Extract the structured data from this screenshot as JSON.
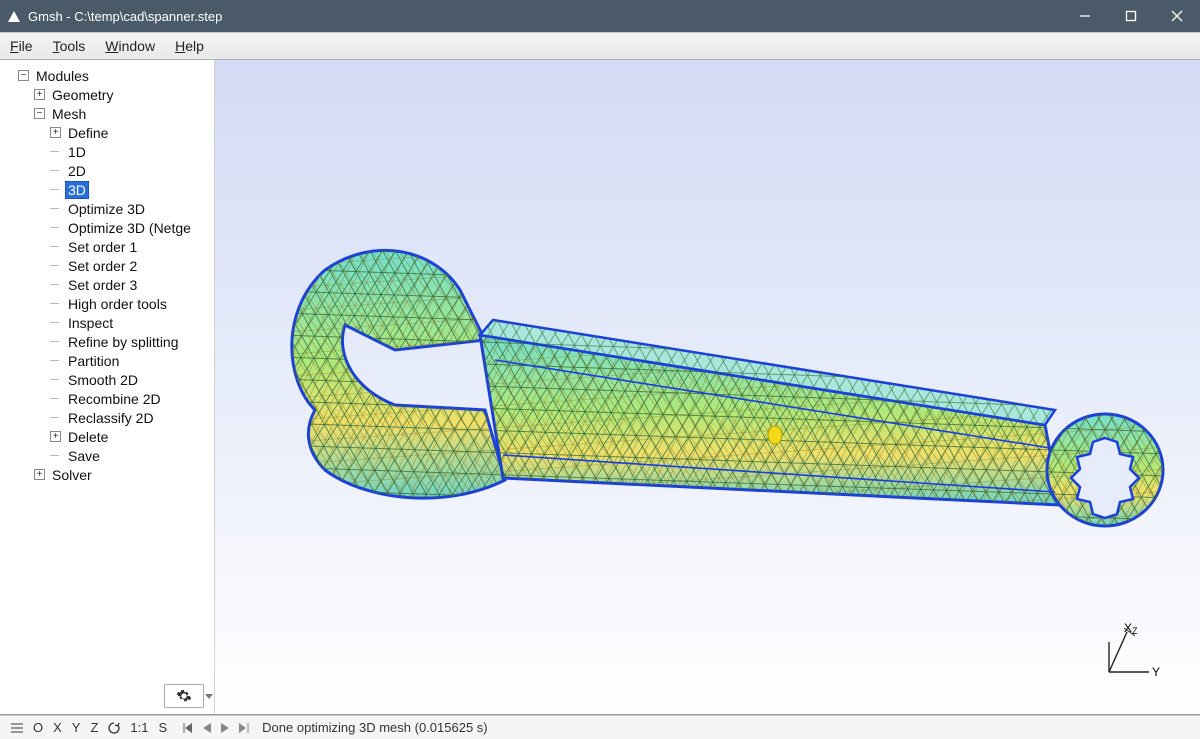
{
  "window": {
    "title": "Gmsh - C:\\temp\\cad\\spanner.step"
  },
  "menu": {
    "file": "File",
    "tools": "Tools",
    "window": "Window",
    "help": "Help"
  },
  "tree": {
    "root": "Modules",
    "geometry": "Geometry",
    "mesh": "Mesh",
    "define": "Define",
    "items": [
      "1D",
      "2D",
      "3D",
      "Optimize 3D",
      "Optimize 3D (Netge",
      "Set order 1",
      "Set order 2",
      "Set order 3",
      "High order tools",
      "Inspect",
      "Refine by splitting",
      "Partition",
      "Smooth 2D",
      "Recombine 2D",
      "Reclassify 2D"
    ],
    "delete": "Delete",
    "save": "Save",
    "solver": "Solver",
    "selected_index": 2
  },
  "axes": {
    "x_label": "X",
    "y_label": "Y",
    "z_label": "Z"
  },
  "status": {
    "buttons": [
      "O",
      "X",
      "Y",
      "Z"
    ],
    "rotate_icon": "↻",
    "scale": "1:1",
    "s_label": "S",
    "message": "Done optimizing 3D mesh (0.015625 s)"
  },
  "icons": {
    "gear": "gear-icon",
    "hamburger": "menu-icon"
  },
  "colors": {
    "selection": "#2a6ed8",
    "mesh_edge_blue": "#1a3fe0",
    "mesh_fill_cyan": "#5fd6c9",
    "mesh_fill_yellow": "#f4e06a",
    "mesh_fill_green": "#58c66e"
  }
}
